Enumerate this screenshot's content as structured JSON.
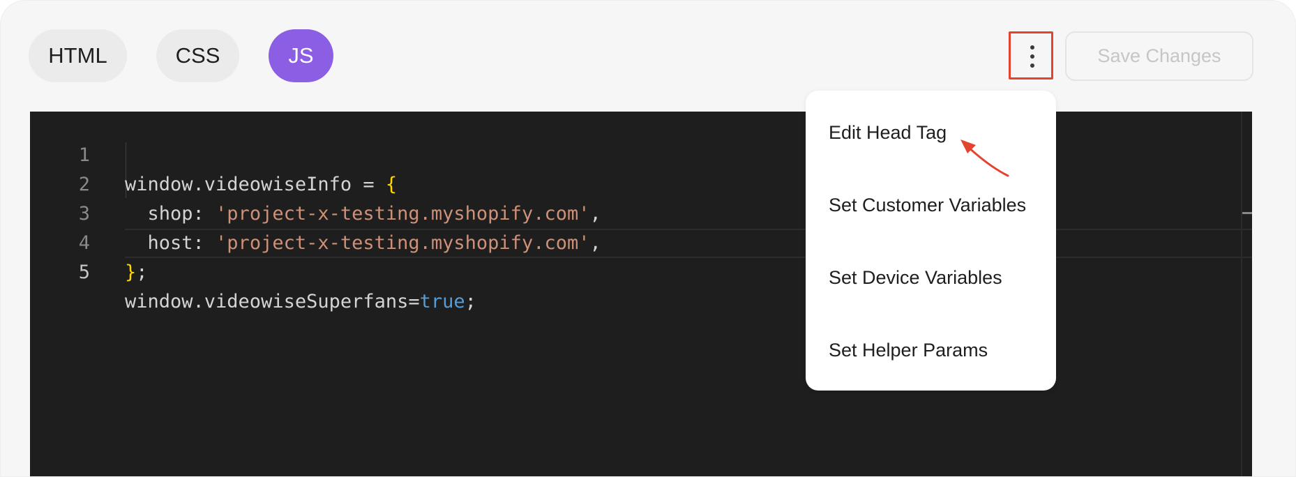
{
  "tabs": [
    {
      "label": "HTML",
      "active": false
    },
    {
      "label": "CSS",
      "active": false
    },
    {
      "label": "JS",
      "active": true
    }
  ],
  "toolbar": {
    "more_icon": "vertical-ellipsis-icon",
    "save_label": "Save Changes"
  },
  "editor": {
    "line_numbers": [
      "1",
      "2",
      "3",
      "4",
      "5"
    ],
    "lines": [
      {
        "a": "window.videowiseInfo = ",
        "b": "{"
      },
      {
        "a": "  shop: ",
        "b": "'project-x-testing.myshopify.com'",
        "c": ","
      },
      {
        "a": "  host: ",
        "b": "'project-x-testing.myshopify.com'",
        "c": ","
      },
      {
        "a": "}",
        "b": ";"
      },
      {
        "a": "window.videowiseSuperfans=",
        "b": "true",
        "c": ";"
      }
    ]
  },
  "menu": {
    "items": [
      "Edit Head Tag",
      "Set Customer Variables",
      "Set Device Variables",
      "Set Helper Params"
    ]
  },
  "colors": {
    "accent": "#8c5ee3",
    "highlight_border": "#e4432d",
    "annotation_arrow": "#e4432d"
  }
}
